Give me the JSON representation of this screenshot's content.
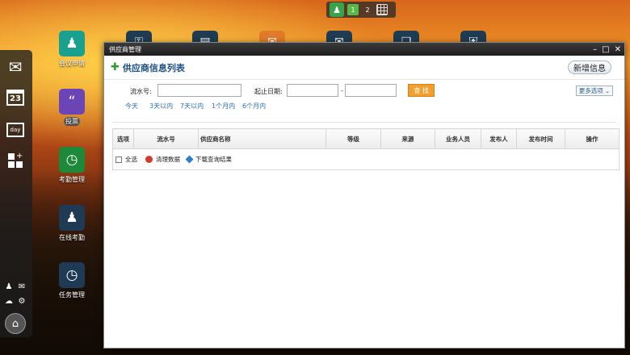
{
  "taskbar": {
    "pages": [
      "1",
      "2"
    ]
  },
  "dock": {
    "icons": [
      "mail-icon",
      "calendar-icon",
      "day-icon",
      "add-app-icon"
    ],
    "calendar_day": "23",
    "day_text": "day"
  },
  "desktop": {
    "icons": [
      {
        "label": "会议申请",
        "icon": "meeting-icon",
        "color": "#1aa08e"
      },
      {
        "label": "投票",
        "icon": "vote-icon",
        "color": "#6b44b8"
      },
      {
        "label": "考勤管理",
        "icon": "clock-icon",
        "color": "#1d8a3a"
      },
      {
        "label": "在线考勤",
        "icon": "user-icon",
        "color": "#1e3a55"
      },
      {
        "label": "任务管理",
        "icon": "task-clock-icon",
        "color": "#1e3a55"
      }
    ]
  },
  "window": {
    "title": "供应商管理",
    "header_title": "供应商信息列表",
    "add_button": "新增信息",
    "filter": {
      "serial_label": "流水号:",
      "date_label": "起止日期:",
      "date_sep": "-",
      "search_button": "查 找",
      "more_options": "更多选项",
      "quick_ranges": [
        "今天",
        "3天以内",
        "7天以内",
        "1个月内",
        "6个月内"
      ]
    },
    "table": {
      "columns": [
        "选项",
        "流水号",
        "供应商名称",
        "等级",
        "来源",
        "业务人员",
        "发布人",
        "发布时间",
        "操作"
      ]
    },
    "footer": {
      "select_all": "全选",
      "clear_data": "清理数据",
      "download_results": "下载查询结果"
    }
  }
}
